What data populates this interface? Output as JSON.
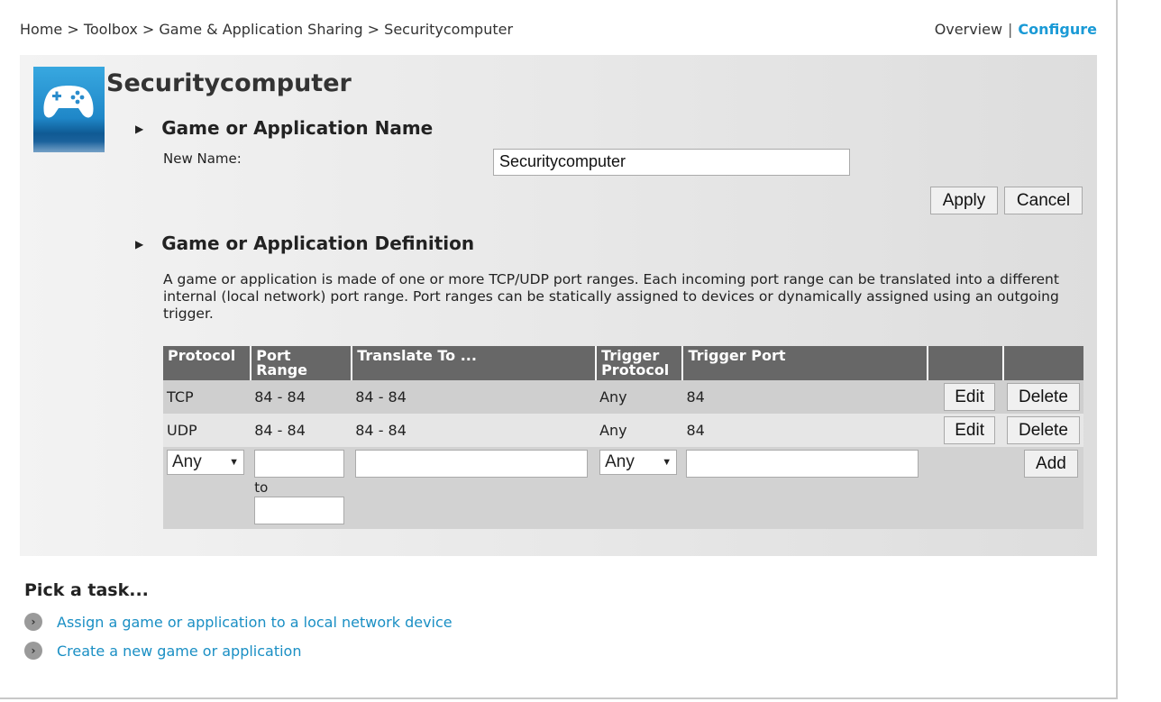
{
  "breadcrumb": "Home > Toolbox > Game & Application Sharing > Securitycomputer",
  "viewnav": {
    "overview": "Overview",
    "separator": "|",
    "configure": "Configure"
  },
  "page_title": "Securitycomputer",
  "name_section": {
    "heading": "Game or Application Name",
    "new_name_label": "New Name:",
    "new_name_value": "Securitycomputer",
    "apply": "Apply",
    "cancel": "Cancel"
  },
  "definition_section": {
    "heading": "Game or Application Definition",
    "description": "A game or application is made of one or more TCP/UDP port ranges. Each incoming port range can be translated into a different internal (local network) port range. Port ranges can be statically assigned to devices or dynamically assigned using an outgoing trigger."
  },
  "table": {
    "headers": [
      "Protocol",
      "Port Range",
      "Translate To ...",
      "Trigger Protocol",
      "Trigger Port"
    ],
    "rows": [
      {
        "protocol": "TCP",
        "port_range": "84 - 84",
        "translate_to": "84 - 84",
        "trigger_protocol": "Any",
        "trigger_port": "84",
        "edit": "Edit",
        "delete": "Delete"
      },
      {
        "protocol": "UDP",
        "port_range": "84 - 84",
        "translate_to": "84 - 84",
        "trigger_protocol": "Any",
        "trigger_port": "84",
        "edit": "Edit",
        "delete": "Delete"
      }
    ],
    "new_row": {
      "protocol": "Any",
      "to_label": "to",
      "trigger_protocol": "Any",
      "add": "Add"
    }
  },
  "tasks": {
    "heading": "Pick a task...",
    "items": [
      "Assign a game or application to a local network device",
      "Create a new game or application"
    ]
  },
  "colors": {
    "accent": "#1a9ad6",
    "table_header": "#676767"
  }
}
